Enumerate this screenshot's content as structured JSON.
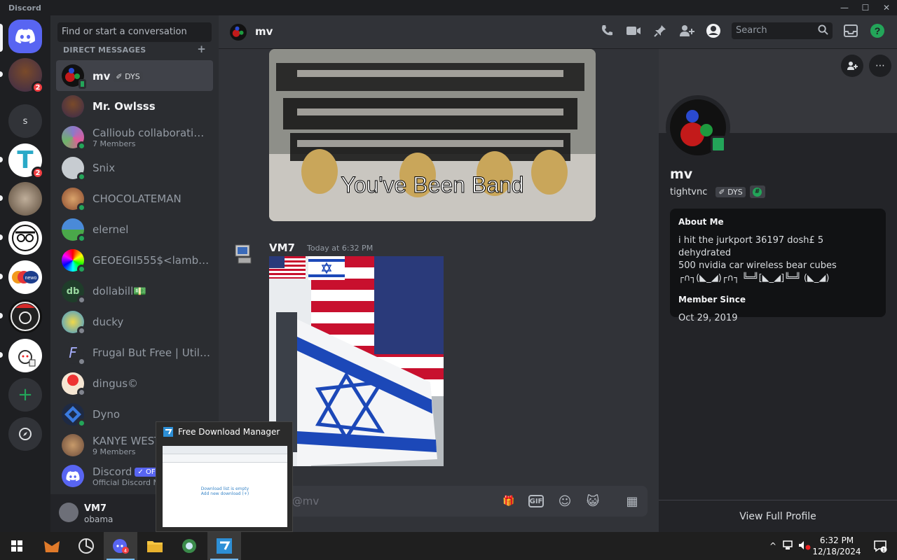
{
  "window": {
    "app_name": "Discord",
    "controls": [
      "—",
      "☐",
      "✕"
    ]
  },
  "servers": [
    {
      "name": "home",
      "badge": ""
    },
    {
      "name": "server-1",
      "badge": "2"
    },
    {
      "name": "s",
      "label": "s",
      "badge": ""
    },
    {
      "name": "server-t",
      "badge": "2"
    },
    {
      "name": "server-4",
      "badge": ""
    },
    {
      "name": "server-5",
      "badge": ""
    },
    {
      "name": "server-newo",
      "badge": ""
    },
    {
      "name": "server-7",
      "badge": ""
    },
    {
      "name": "server-8",
      "badge": ""
    }
  ],
  "dm_sidebar": {
    "search_placeholder": "Find or start a conversation",
    "header": "DIRECT MESSAGES",
    "add": "+",
    "items": [
      {
        "name": "mv",
        "tag": "DYS",
        "sub": "",
        "active": true
      },
      {
        "name": "Mr. Owlsss",
        "sub": ""
      },
      {
        "name": "Callioub collaborating...",
        "sub": "7 Members"
      },
      {
        "name": "Snix",
        "sub": ""
      },
      {
        "name": "CHOCOLATEMAN",
        "sub": ""
      },
      {
        "name": "elernel",
        "sub": ""
      },
      {
        "name": "GEOEGII555$<lambd...",
        "sub": ""
      },
      {
        "name": "dollabill💵",
        "sub": ""
      },
      {
        "name": "ducky",
        "sub": ""
      },
      {
        "name": "Frugal But Free | Utilit...",
        "sub": ""
      },
      {
        "name": "dingus©",
        "sub": ""
      },
      {
        "name": "Dyno",
        "sub": ""
      },
      {
        "name": "KANYE WEST",
        "sub": "9 Members"
      },
      {
        "name": "Discord",
        "tag": "OF",
        "sub": "Official Discord M"
      }
    ]
  },
  "user_panel": {
    "name": "VM7",
    "status": "obama"
  },
  "chat": {
    "title": "mv",
    "search_placeholder": "Search",
    "image1_caption": "You've Been Band",
    "message2": {
      "author": "VM7",
      "time": "Today at 6:32 PM"
    },
    "composer_placeholder": "age @mv",
    "composer_buttons": [
      "🎁",
      "GIF",
      "☺",
      "😺",
      "▦"
    ]
  },
  "profile": {
    "name": "mv",
    "username": "tightvnc",
    "tag": "DYS",
    "about_title": "About Me",
    "about_text": "i hit the jurkport 36197 dosh£ 5 dehydrated\n500 nvidia car wireless bear cubes\n┌∩┐(◣_◢)┌∩┐ ╚═╝[◣_◢]╚═╝ (◣_◢)",
    "member_since_title": "Member Since",
    "member_since": "Oct 29, 2019",
    "view_full": "View Full Profile"
  },
  "fdm_popup": {
    "title": "Free Download Manager",
    "thumb_text": "Download list is empty\nAdd new download (+)"
  },
  "taskbar": {
    "time": "6:32 PM",
    "date": "12/18/2024",
    "notification_count": "1",
    "discord_badge": "4"
  },
  "colors": {
    "online": "#23a559",
    "idle": "#f0b232",
    "offline": "#80848e",
    "badge": "#f23f43",
    "blurple": "#5865f2"
  }
}
